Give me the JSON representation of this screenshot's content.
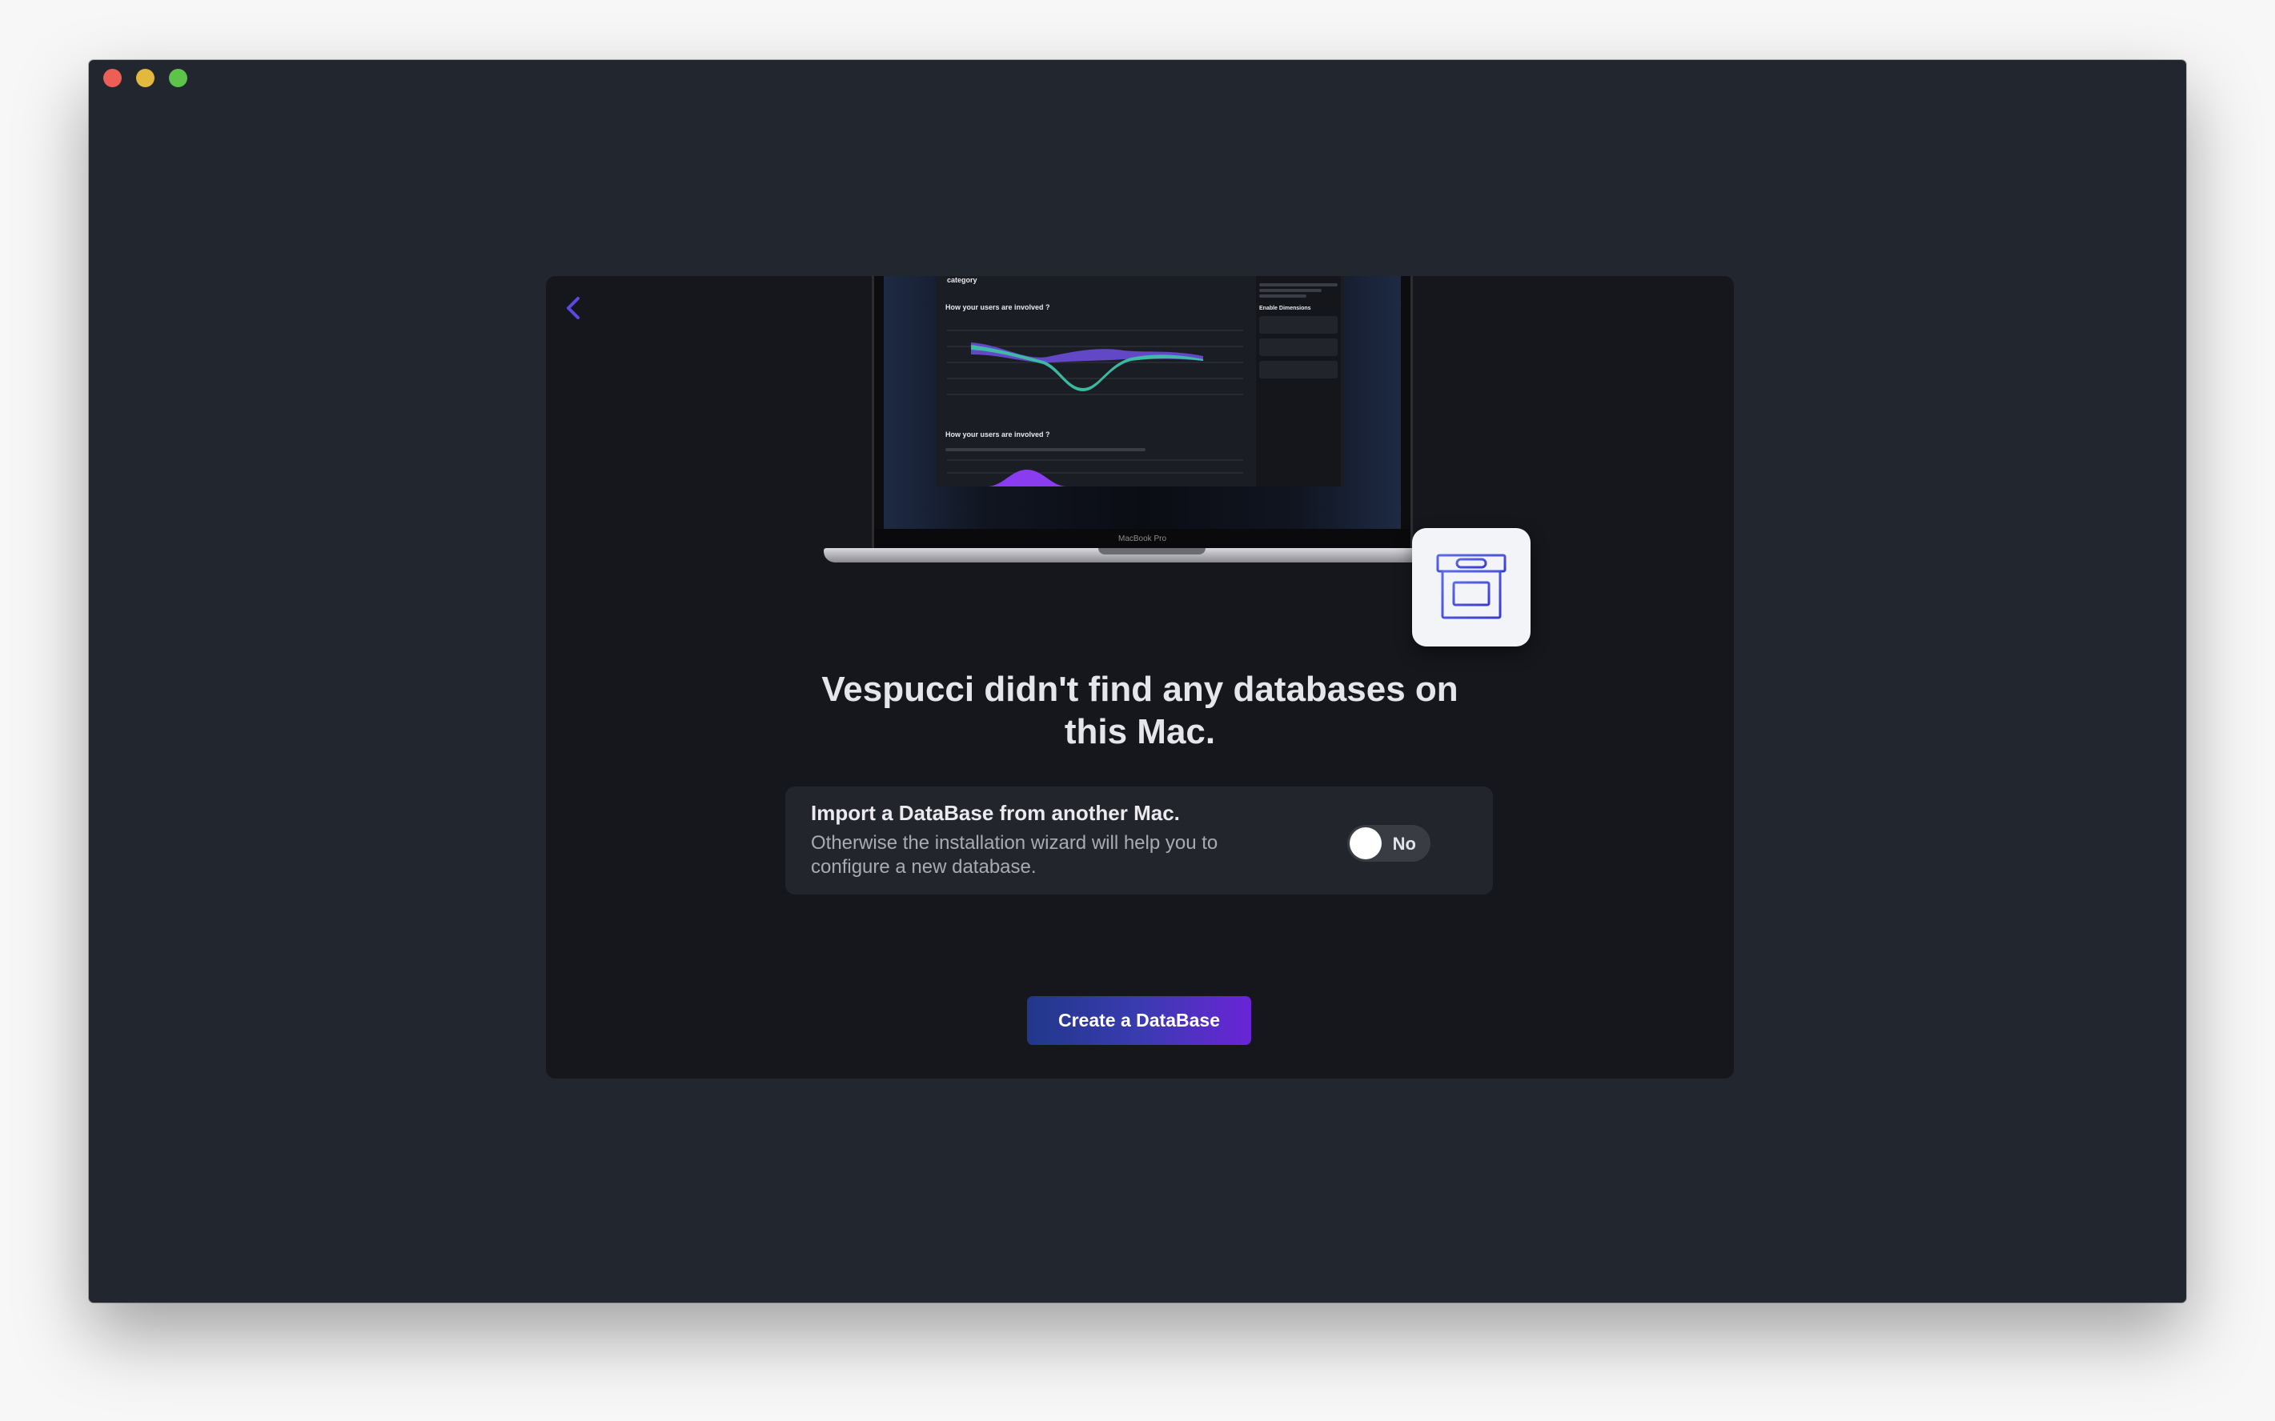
{
  "window": {
    "controls": [
      "close",
      "minimize",
      "zoom"
    ]
  },
  "back": {
    "icon": "chevron-left-icon",
    "color": "#5b49e0"
  },
  "illustration": {
    "device_label": "MacBook Pro",
    "screen_text": {
      "category": "category",
      "section_1": "How your users are involved ?",
      "section_2": "How your users are involved ?",
      "side_title": "Enable Dimensions"
    },
    "badge_icon": "archive-box-icon"
  },
  "heading": {
    "line1": "Vespucci didn't find any databases on",
    "line2": "this Mac."
  },
  "import": {
    "title": "Import a DataBase from another Mac.",
    "description_line1": "Otherwise the installation wizard will help you to",
    "description_line2": "configure a new database.",
    "toggle_label": "No",
    "toggle_on": false
  },
  "primary_button": {
    "label": "Create a DataBase"
  },
  "colors": {
    "window_bg": "#22262e",
    "panel_bg": "#16171d",
    "card_bg": "#23252c",
    "accent_start": "#21378a",
    "accent_end": "#6a24d6"
  }
}
